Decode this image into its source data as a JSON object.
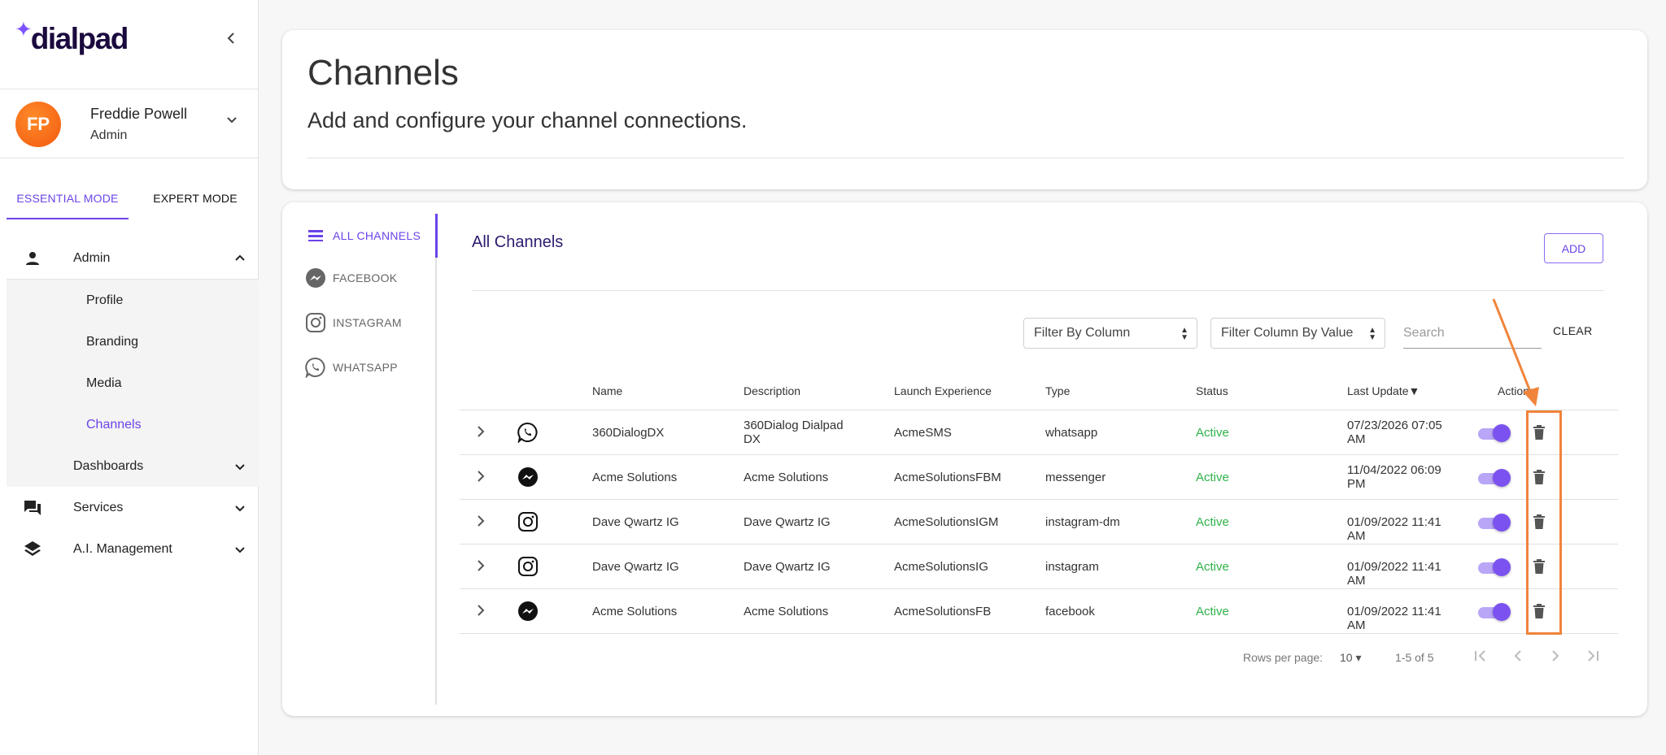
{
  "brand": {
    "logo_text": "dialpad"
  },
  "user": {
    "initials": "FP",
    "name": "Freddie Powell",
    "role": "Admin"
  },
  "modes": {
    "essential": "ESSENTIAL MODE",
    "expert": "EXPERT MODE"
  },
  "nav": {
    "admin": "Admin",
    "admin_items": [
      "Profile",
      "Branding",
      "Media",
      "Channels"
    ],
    "dashboards": "Dashboards",
    "services": "Services",
    "ai_management": "A.I. Management"
  },
  "header": {
    "title": "Channels",
    "subtitle": "Add and configure your channel connections."
  },
  "channel_nav": [
    "ALL CHANNELS",
    "FACEBOOK",
    "INSTAGRAM",
    "WHATSAPP"
  ],
  "section": {
    "title": "All Channels",
    "add_label": "ADD"
  },
  "filters": {
    "by_column": "Filter By Column",
    "by_value": "Filter Column By Value",
    "search_placeholder": "Search",
    "clear_label": "CLEAR"
  },
  "table": {
    "columns": [
      "Name",
      "Description",
      "Launch Experience",
      "Type",
      "Status",
      "Last Update",
      "Actions"
    ],
    "sort_indicator": "▼",
    "rows": [
      {
        "icon": "whatsapp-icon",
        "name": "360DialogDX",
        "description": "360Dialog Dialpad DX",
        "launch": "AcmeSMS",
        "type": "whatsapp",
        "status": "Active",
        "updated": "07/23/2026 07:05 AM",
        "enabled": true
      },
      {
        "icon": "messenger-icon",
        "name": "Acme Solutions",
        "description": "Acme Solutions",
        "launch": "AcmeSolutionsFBM",
        "type": "messenger",
        "status": "Active",
        "updated": "11/04/2022 06:09 PM",
        "enabled": true
      },
      {
        "icon": "instagram-icon",
        "name": "Dave Qwartz IG",
        "description": "Dave Qwartz IG",
        "launch": "AcmeSolutionsIGM",
        "type": "instagram-dm",
        "status": "Active",
        "updated": "01/09/2022 11:41 AM",
        "enabled": true
      },
      {
        "icon": "instagram-icon",
        "name": "Dave Qwartz IG",
        "description": "Dave Qwartz IG",
        "launch": "AcmeSolutionsIG",
        "type": "instagram",
        "status": "Active",
        "updated": "01/09/2022 11:41 AM",
        "enabled": true
      },
      {
        "icon": "messenger-icon",
        "name": "Acme Solutions",
        "description": "Acme Solutions",
        "launch": "AcmeSolutionsFB",
        "type": "facebook",
        "status": "Active",
        "updated": "01/09/2022 11:41 AM",
        "enabled": true
      }
    ]
  },
  "pagination": {
    "rows_label": "Rows per page:",
    "rows_value": "10",
    "range": "1-5 of 5"
  },
  "colors": {
    "accent": "#6b43e8",
    "active_status": "#2fb24a",
    "annotation": "#f0843b",
    "avatar": "#f25a0e"
  }
}
